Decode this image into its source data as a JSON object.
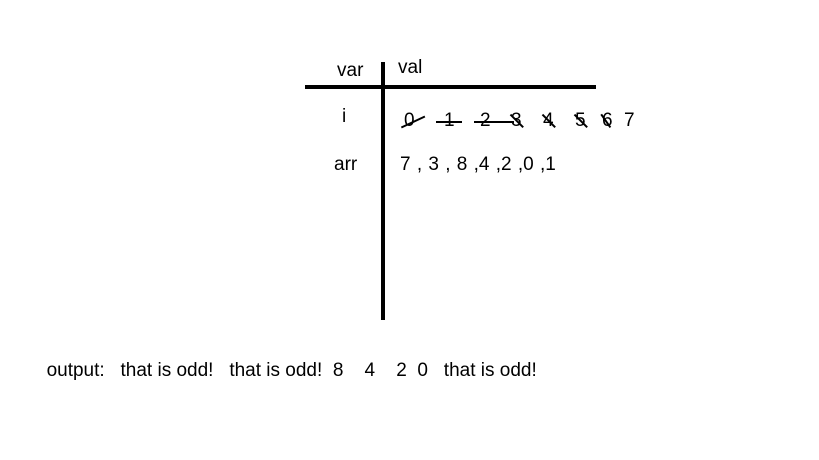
{
  "table": {
    "header_var": "var",
    "header_val": "val",
    "rows": [
      {
        "var": "i",
        "values": [
          "0",
          "1",
          "2",
          "3",
          "4",
          "5",
          "6",
          "7"
        ],
        "crossed_out": [
          "0",
          "1",
          "2",
          "3",
          "4",
          "5",
          "6"
        ]
      },
      {
        "var": "arr",
        "value_text": "7 , 3 , 8 ,4 ,2 ,0 ,1"
      }
    ]
  },
  "output": {
    "label": "output:",
    "items": [
      "that is odd!",
      "that is odd!",
      "8",
      "4",
      "2",
      "0",
      "that is odd!"
    ]
  }
}
